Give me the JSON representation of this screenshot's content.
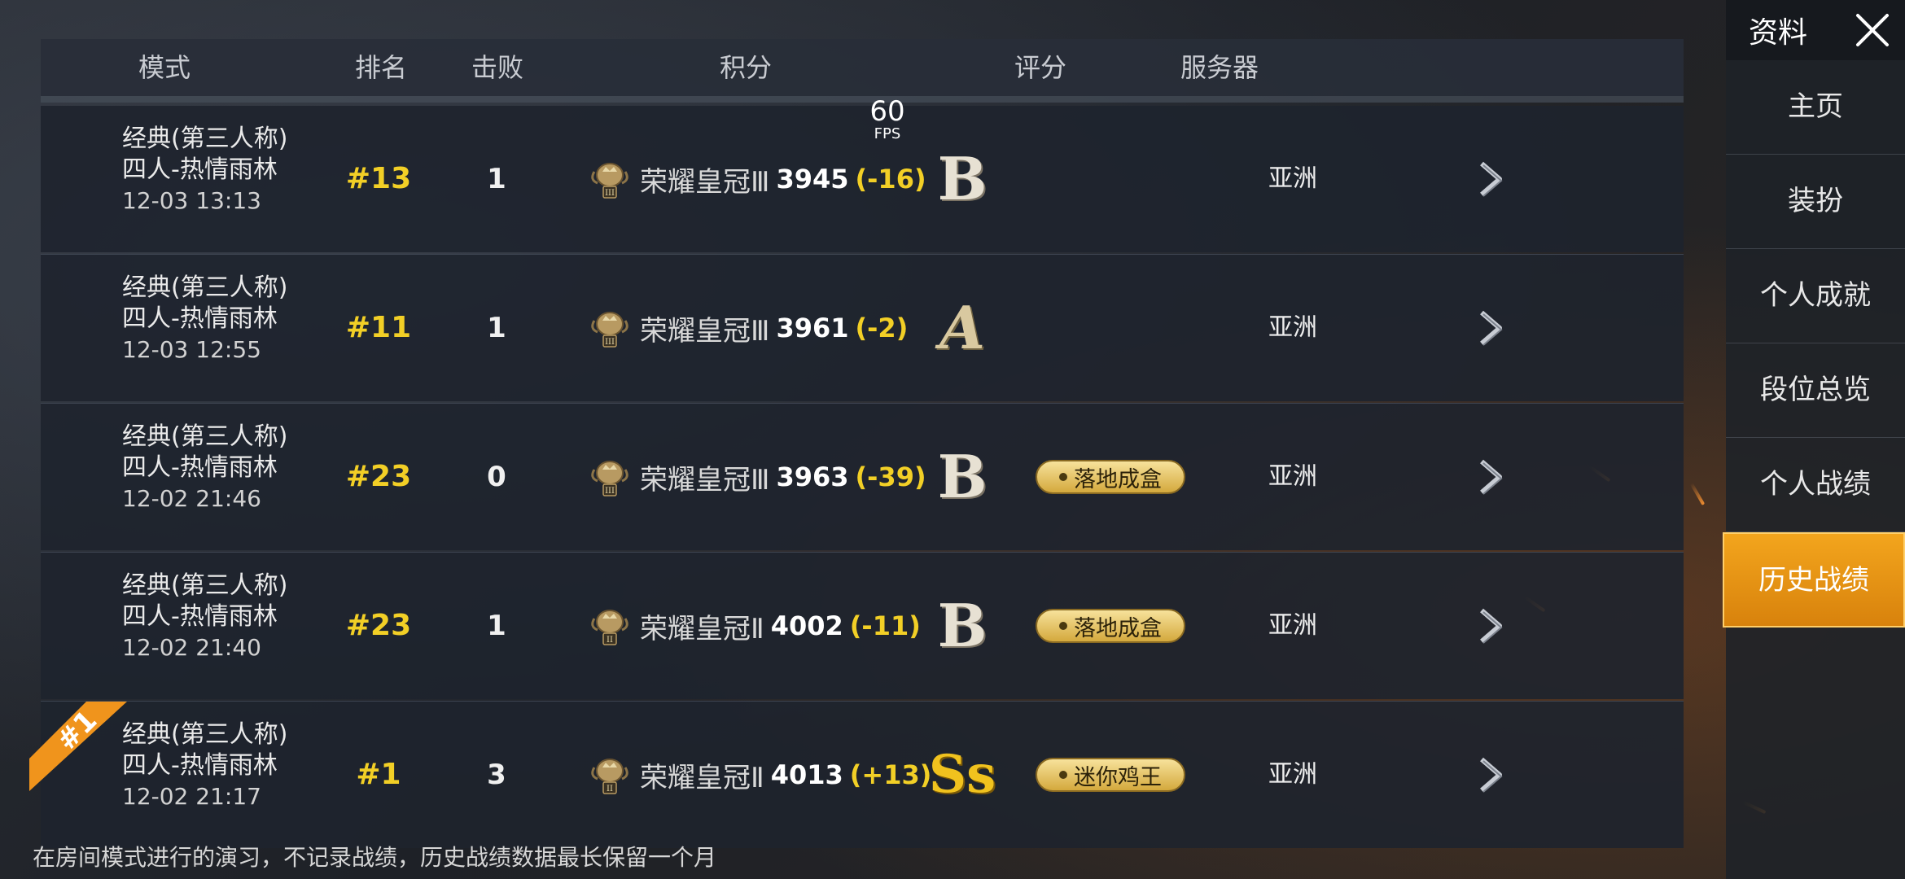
{
  "header": {
    "mode": "模式",
    "rank": "排名",
    "kills": "击败",
    "score": "积分",
    "rating": "评分",
    "server": "服务器"
  },
  "fps": {
    "value": "60",
    "label": "FPS"
  },
  "rows": [
    {
      "mode": "经典(第三人称)",
      "map": "四人-热情雨林",
      "date": "12-03 13:13",
      "rank": "#13",
      "kills": "1",
      "tier": "荣耀皇冠Ⅲ",
      "points": "3945",
      "delta": "(-16)",
      "grade": "B",
      "badge": "",
      "server": "亚洲"
    },
    {
      "mode": "经典(第三人称)",
      "map": "四人-热情雨林",
      "date": "12-03 12:55",
      "rank": "#11",
      "kills": "1",
      "tier": "荣耀皇冠Ⅲ",
      "points": "3961",
      "delta": "(-2)",
      "grade": "A",
      "badge": "",
      "server": "亚洲"
    },
    {
      "mode": "经典(第三人称)",
      "map": "四人-热情雨林",
      "date": "12-02 21:46",
      "rank": "#23",
      "kills": "0",
      "tier": "荣耀皇冠Ⅲ",
      "points": "3963",
      "delta": "(-39)",
      "grade": "B",
      "badge": "落地成盒",
      "server": "亚洲"
    },
    {
      "mode": "经典(第三人称)",
      "map": "四人-热情雨林",
      "date": "12-02 21:40",
      "rank": "#23",
      "kills": "1",
      "tier": "荣耀皇冠Ⅱ",
      "points": "4002",
      "delta": "(-11)",
      "grade": "B",
      "badge": "落地成盒",
      "server": "亚洲"
    },
    {
      "mode": "经典(第三人称)",
      "map": "四人-热情雨林",
      "date": "12-02 21:17",
      "rank": "#1",
      "kills": "3",
      "tier": "荣耀皇冠Ⅱ",
      "points": "4013",
      "delta": "(+13)",
      "grade": "Ss",
      "badge": "迷你鸡王",
      "server": "亚洲",
      "flag": "#1"
    }
  ],
  "footnote": "在房间模式进行的演习，不记录战绩，历史战绩数据最长保留一个月",
  "sidebar": {
    "title": "资料",
    "items": [
      "主页",
      "装扮",
      "个人成就",
      "段位总览",
      "个人战绩",
      "历史战绩"
    ],
    "active": "历史战绩"
  },
  "colors": {
    "accent": "#f2cf26",
    "active_tab": "#e8920f",
    "badge": "#e6c060"
  }
}
